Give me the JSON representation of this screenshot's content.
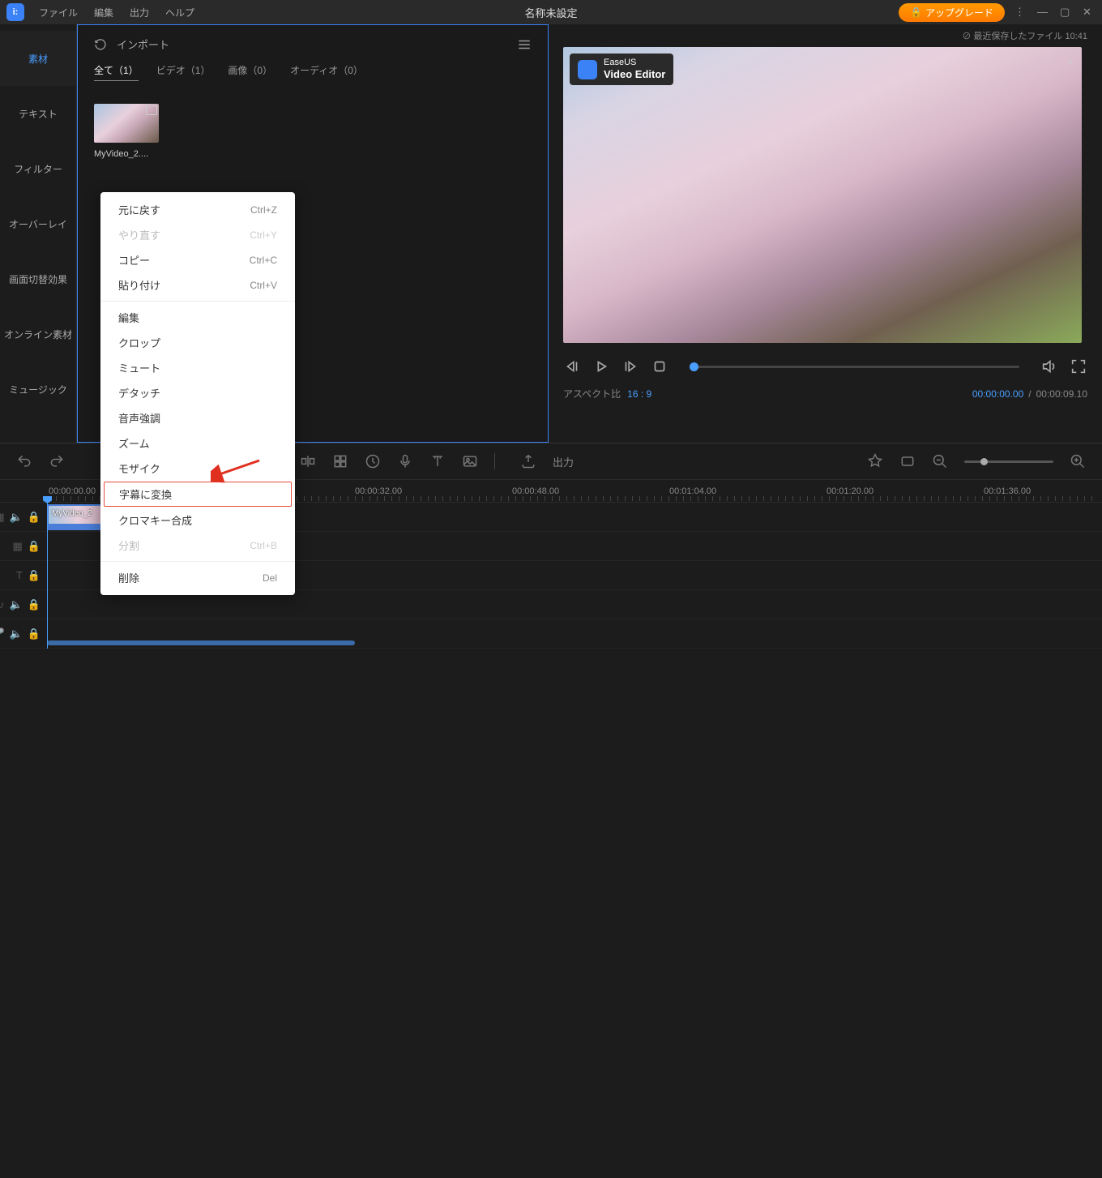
{
  "titlebar": {
    "menus": [
      "ファイル",
      "編集",
      "出力",
      "ヘルプ"
    ],
    "title": "名称未設定",
    "upgrade": "アップグレード",
    "save_info": "⊘ 最近保存したファイル 10:41"
  },
  "sidebar": {
    "tabs": [
      "素材",
      "テキスト",
      "フィルター",
      "オーバーレイ",
      "画面切替効果",
      "オンライン素材",
      "ミュージック"
    ]
  },
  "media": {
    "import": "インポート",
    "filters": [
      {
        "label": "全て（1）",
        "active": true
      },
      {
        "label": "ビデオ（1）",
        "active": false
      },
      {
        "label": "画像（0）",
        "active": false
      },
      {
        "label": "オーディオ（0）",
        "active": false
      }
    ],
    "items": [
      {
        "name": "MyVideo_2...."
      }
    ]
  },
  "preview": {
    "badge_top": "EaseUS",
    "badge_bottom": "Video Editor",
    "aspect_label": "アスペクト比",
    "aspect_value": "16 : 9",
    "time_current": "00:00:00.00",
    "time_total": "00:00:09.10"
  },
  "timeline": {
    "export": "出力",
    "ruler": [
      "00:00:00.00",
      "00:00:32.00",
      "00:00:48.00",
      "00:01:04.00",
      "00:01:20.00",
      "00:01:36.00"
    ],
    "ruler_pos": [
      60,
      438,
      632,
      826,
      1020,
      1214
    ],
    "clip_label": "MyVideo_2"
  },
  "context_menu": [
    {
      "label": "元に戻す",
      "shortcut": "Ctrl+Z",
      "disabled": false
    },
    {
      "label": "やり直す",
      "shortcut": "Ctrl+Y",
      "disabled": true
    },
    {
      "label": "コピー",
      "shortcut": "Ctrl+C",
      "disabled": false
    },
    {
      "label": "貼り付け",
      "shortcut": "Ctrl+V",
      "disabled": false
    },
    {
      "sep": true
    },
    {
      "label": "編集",
      "disabled": false
    },
    {
      "label": "クロップ",
      "disabled": false
    },
    {
      "label": "ミュート",
      "disabled": false
    },
    {
      "label": "デタッチ",
      "disabled": false
    },
    {
      "label": "音声強調",
      "disabled": false
    },
    {
      "label": "ズーム",
      "disabled": false
    },
    {
      "label": "モザイク",
      "disabled": false
    },
    {
      "label": "字幕に変換",
      "highlight": true,
      "disabled": false
    },
    {
      "label": "クロマキー合成",
      "disabled": false
    },
    {
      "label": "分割",
      "shortcut": "Ctrl+B",
      "disabled": true
    },
    {
      "sep": true
    },
    {
      "label": "削除",
      "shortcut": "Del",
      "disabled": false
    }
  ]
}
